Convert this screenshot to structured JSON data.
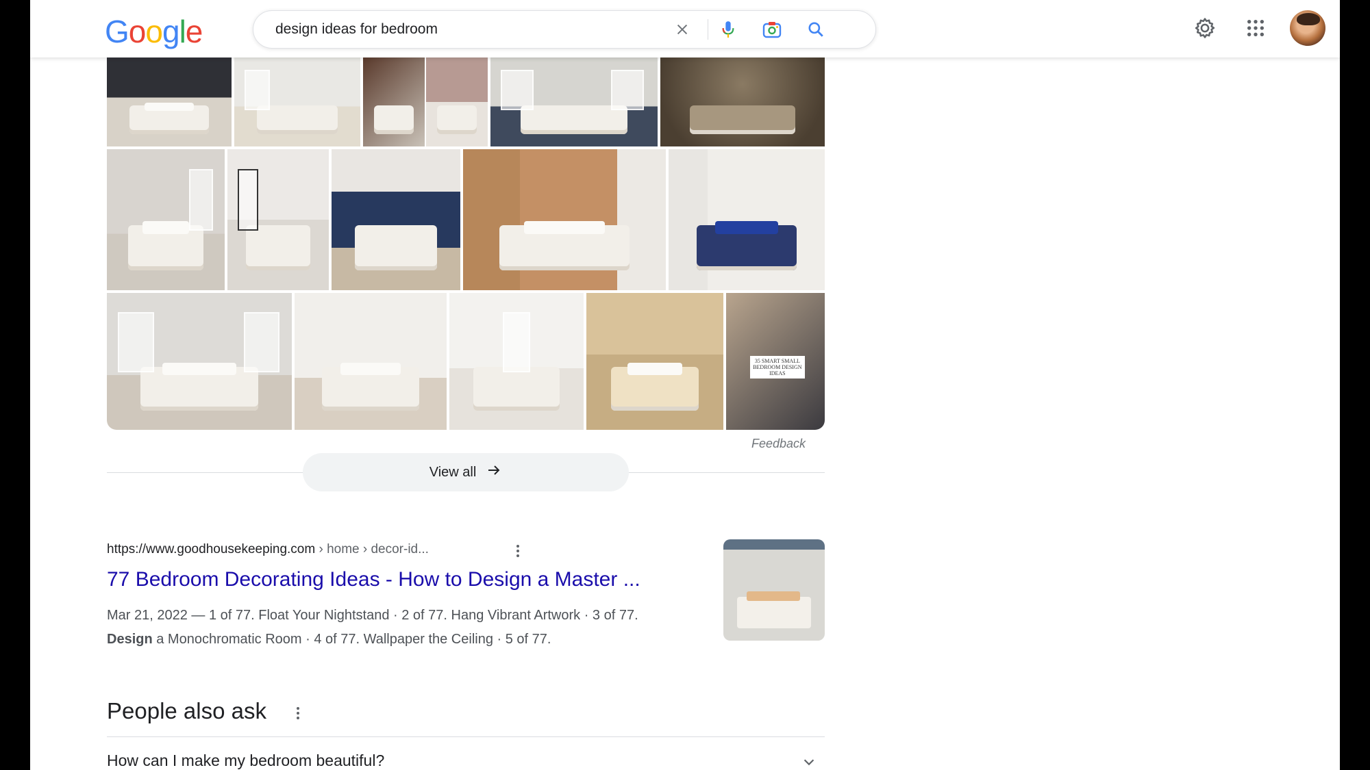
{
  "header": {
    "logo_letters": [
      {
        "ch": "G",
        "color": "#4285F4"
      },
      {
        "ch": "o",
        "color": "#EA4335"
      },
      {
        "ch": "o",
        "color": "#FBBC05"
      },
      {
        "ch": "g",
        "color": "#4285F4"
      },
      {
        "ch": "l",
        "color": "#34A853"
      },
      {
        "ch": "e",
        "color": "#EA4335"
      }
    ],
    "search_query": "design ideas for bedroom",
    "icons": [
      "close-icon",
      "microphone-icon",
      "camera-icon",
      "search-icon",
      "gear-icon",
      "apps-grid-icon",
      "avatar"
    ]
  },
  "images": {
    "feedback_label": "Feedback",
    "view_all_label": "View all",
    "tile_overlay_text": "35 SMART SMALL BEDROOM DESIGN IDEAS"
  },
  "result": {
    "url": "https://www.goodhousekeeping.com",
    "breadcrumb": " › home › decor-id...",
    "title": "77 Bedroom Decorating Ideas - How to Design a Master ...",
    "snippet_line1": "Mar 21, 2022 — 1 of 77. Float Your Nightstand · 2 of 77. Hang Vibrant Artwork · 3 of 77.",
    "snippet_bold": "Design",
    "snippet_line2": " a Monochromatic Room · 4 of 77. Wallpaper the Ceiling · 5 of 77."
  },
  "people_also_ask": {
    "heading": "People also ask",
    "questions": [
      "How can I make my bedroom beautiful?"
    ]
  },
  "colors": {
    "link": "#1a0dab",
    "text": "#202124",
    "muted": "#4d5156"
  }
}
